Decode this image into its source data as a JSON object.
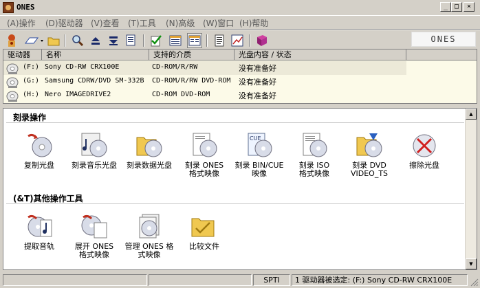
{
  "window": {
    "title": "ONES"
  },
  "menu": [
    {
      "label": "(A)操作"
    },
    {
      "label": "(D)驱动器"
    },
    {
      "label": "(V)查看"
    },
    {
      "label": "(T)工具"
    },
    {
      "label": "(N)高级"
    },
    {
      "label": "(W)窗口"
    },
    {
      "label": "(H)帮助"
    }
  ],
  "toolbar": {
    "buttons": [
      "burner-icon",
      "eraser-icon",
      "folder-icon",
      "search-drive-icon",
      "eject-icon",
      "close-tray-icon",
      "properties-icon",
      "check-icon",
      "list-view-icon",
      "detail-view-icon",
      "document-icon",
      "chart-icon",
      "book-icon"
    ]
  },
  "logo": {
    "text": "ONES"
  },
  "drives": {
    "headers": [
      "驱动器",
      "名称",
      "支持的介质",
      "光盘内容 / 状态"
    ],
    "rows": [
      {
        "letter": "(F:)",
        "name": "Sony CD-RW CRX100E",
        "media": "CD-ROM/R/RW",
        "status": "没有准备好"
      },
      {
        "letter": "(G:)",
        "name": "Samsung CDRW/DVD SM-332B",
        "media": "CD-ROM/R/RW DVD-ROM",
        "status": "没有准备好"
      },
      {
        "letter": "(H:)",
        "name": "Nero IMAGEDRIVE2",
        "media": "CD-ROM DVD-ROM",
        "status": "没有准备好"
      }
    ]
  },
  "sections": {
    "burn": {
      "title": "刻录操作",
      "items": [
        {
          "label": "复制光盘",
          "icon": "copy-disc-icon"
        },
        {
          "label": "刻录音乐光盘",
          "icon": "music-disc-icon"
        },
        {
          "label": "刻录数据光盘",
          "icon": "data-disc-icon"
        },
        {
          "label": "刻录 ONES\n格式映像",
          "icon": "ones-image-icon"
        },
        {
          "label": "刻录 BIN/CUE\n映像",
          "icon": "bincue-icon"
        },
        {
          "label": "刻录 ISO\n格式映像",
          "icon": "iso-icon"
        },
        {
          "label": "刻录 DVD\nVIDEO_TS",
          "icon": "dvd-video-icon"
        },
        {
          "label": "擦除光盘",
          "icon": "erase-disc-icon"
        }
      ]
    },
    "tools": {
      "title": "(&T)其他操作工具",
      "items": [
        {
          "label": "提取音轨",
          "icon": "extract-audio-icon"
        },
        {
          "label": "展开 ONES\n格式映像",
          "icon": "expand-image-icon"
        },
        {
          "label": "管理 ONES 格\n式映像",
          "icon": "manage-image-icon"
        },
        {
          "label": "比较文件",
          "icon": "compare-files-icon"
        }
      ]
    }
  },
  "status": {
    "interface": "SPTI",
    "selected": "1 驱动器被选定: (F:) Sony CD-RW CRX100E"
  },
  "colors": {
    "face": "#d4d0c8",
    "drives_bg": "#fcfae8",
    "selected_row": "#ece9d8"
  }
}
